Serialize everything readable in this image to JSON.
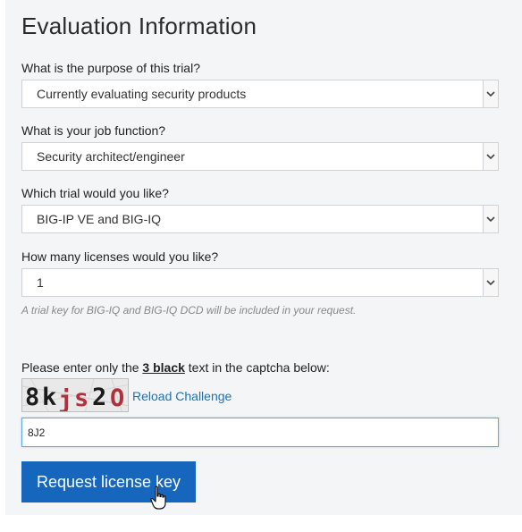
{
  "form": {
    "title": "Evaluation Information",
    "fields": [
      {
        "label": "What is the purpose of this trial?",
        "value": "Currently evaluating security products"
      },
      {
        "label": "What is your job function?",
        "value": "Security architect/engineer"
      },
      {
        "label": "Which trial would you like?",
        "value": "BIG-IP VE and BIG-IQ"
      },
      {
        "label": "How many licenses would you like?",
        "value": "1"
      }
    ],
    "hint": "A trial key for BIG-IQ and BIG-IQ DCD will be included in your request."
  },
  "captcha": {
    "label_prefix": "Please enter only the ",
    "label_emphasis": "3 black",
    "label_suffix": " text in the captcha below:",
    "reload_label": "Reload Challenge",
    "input_value": "8J2",
    "image_characters": [
      "8",
      "k",
      "j",
      "s",
      "2",
      "O"
    ],
    "character_colors": [
      "#1b1b1b",
      "#1b1b1b",
      "#b0303b",
      "#b0303b",
      "#1b1b1b",
      "#b0303b"
    ]
  },
  "submit": {
    "label": "Request license key"
  },
  "colors": {
    "panel_background": "#f4f5f6",
    "link": "#1a73b8",
    "button": "#1766bd",
    "input_focus_border": "#5fa8e3"
  }
}
